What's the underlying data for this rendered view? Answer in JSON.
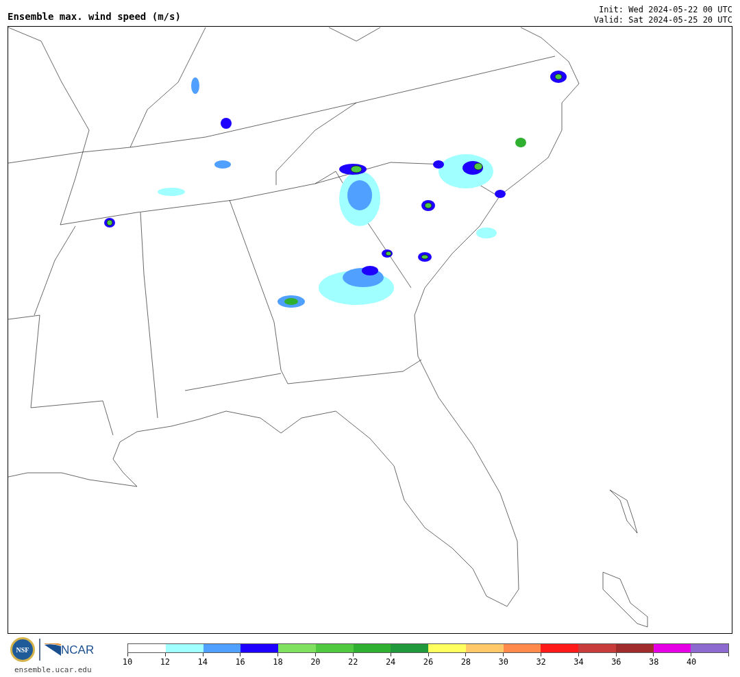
{
  "title": "Ensemble max. wind speed (m/s)",
  "init": "Init: Wed 2024-05-22 00 UTC",
  "valid": "Valid: Sat 2024-05-25 20 UTC",
  "logos": {
    "seal_text": "NSF",
    "ncar_text": "NCAR",
    "url": "ensemble.ucar.edu"
  },
  "colorbar": {
    "bins": [
      {
        "color": "#ffffff"
      },
      {
        "color": "#a0ffff"
      },
      {
        "color": "#50a0ff"
      },
      {
        "color": "#1e00ff"
      },
      {
        "color": "#80e060"
      },
      {
        "color": "#50c840"
      },
      {
        "color": "#30b030"
      },
      {
        "color": "#20983c"
      },
      {
        "color": "#ffff60"
      },
      {
        "color": "#ffc868"
      },
      {
        "color": "#ff8a4c"
      },
      {
        "color": "#ff1a1a"
      },
      {
        "color": "#c83c3c"
      },
      {
        "color": "#a02c2c"
      },
      {
        "color": "#e600e6"
      },
      {
        "color": "#8c6ad0"
      }
    ],
    "ticks": [
      "10",
      "12",
      "14",
      "16",
      "18",
      "20",
      "22",
      "24",
      "26",
      "28",
      "30",
      "32",
      "34",
      "36",
      "38",
      "40"
    ]
  }
}
